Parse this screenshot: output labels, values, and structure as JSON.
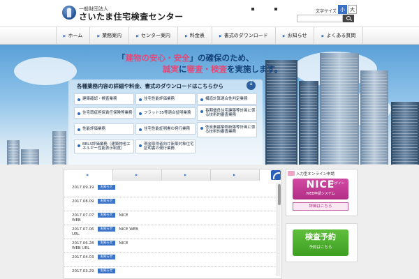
{
  "header": {
    "org_type": "一般財団法人",
    "org_name": "さいたま住宅検査センター",
    "util_link_1": "",
    "util_link_2": "",
    "font_size_label": "文字サイズ",
    "font_small": "小",
    "font_large": "大",
    "search_placeholder": ""
  },
  "nav": {
    "items": [
      "ホーム",
      "業務案内",
      "センター案内",
      "料金表",
      "書式のダウンロード",
      "お知らせ",
      "よくある質問"
    ]
  },
  "hero": {
    "title_line1_pre": "「",
    "title_line1_hl": "建物の安心・安全",
    "title_line1_post": "」の確保のため、",
    "title_line2_pre": "誠実",
    "title_line2_mid1": "に",
    "title_line2_hl": "審査・検査",
    "title_line2_post": "を実施します。",
    "panel_heading": "各種業務内容の詳細や料金、書式のダウンロードはこちらから",
    "services": [
      "建築確認・検査業務",
      "住宅性能評価業務",
      "構造計算適合性判定業務",
      "住宅瑕疵担保責任保険等業務",
      "フラット35等適合証明業務",
      "長期優良住宅建築等計画に係る技術的審査業務",
      "性能評価業務",
      "住宅性能証明書の発行業務",
      "低炭素建築物新築等計画に係る技術的審査業務",
      "BELS評価業務（建築物省エネルギー性能表示制度）",
      "現金取得者向け新築対象住宅証明書の発行業務"
    ]
  },
  "news": {
    "tabs": [
      "",
      "",
      "",
      ""
    ],
    "items": [
      {
        "date": "2017.09.19",
        "badge": "お知らせ",
        "title": "",
        "body": ""
      },
      {
        "date": "2017.08.09",
        "badge": "お知らせ",
        "title": "",
        "body": ""
      },
      {
        "date": "2017.07.07",
        "badge": "お知らせ",
        "title": "NICE",
        "body": "WEB"
      },
      {
        "date": "2017.07.06",
        "badge": "お知らせ",
        "title": "NICE WEB",
        "body": "URL"
      },
      {
        "date": "2017.06.28",
        "badge": "お知らせ",
        "title": "NICE",
        "body": "WEB URL"
      },
      {
        "date": "2017.04.03",
        "badge": "お知らせ",
        "title": "",
        "body": ""
      },
      {
        "date": "2017.03.29",
        "badge": "お知らせ",
        "title": "",
        "body": ""
      }
    ]
  },
  "sidebar": {
    "online_label": "入力型オンライン申請",
    "nice_main": "NICE",
    "nice_login": "ログイン",
    "nice_sub": "WEB申請システム",
    "detail_label": "詳細はこちら",
    "reserve_main": "検査予約",
    "reserve_sub": "予約はこちら"
  },
  "colors": {
    "accent": "#2e6bbf",
    "nice": "#c23b94",
    "reserve": "#4fae2e"
  }
}
